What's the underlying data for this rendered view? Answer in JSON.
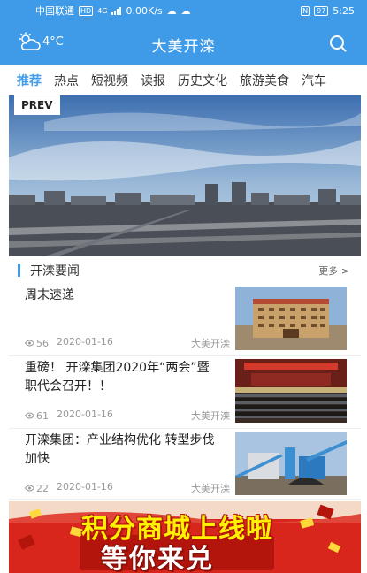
{
  "status_bar": {
    "carrier": "中国联通",
    "hd": "HD",
    "network": "4G",
    "speed": "0.00K/s",
    "nfc": "N",
    "battery": "97",
    "time": "5:25"
  },
  "header": {
    "temperature": "4°C",
    "title": "大美开滦",
    "weather_icon": "cloud-sun-icon",
    "search_icon": "search-icon"
  },
  "tabs": [
    {
      "label": "推荐",
      "active": true
    },
    {
      "label": "热点"
    },
    {
      "label": "短视频"
    },
    {
      "label": "读报"
    },
    {
      "label": "历史文化"
    },
    {
      "label": "旅游美食"
    },
    {
      "label": "汽车"
    }
  ],
  "banner": {
    "prev_label": "PREV"
  },
  "section": {
    "title": "开滦要闻",
    "more": "更多 >"
  },
  "news": [
    {
      "title": "周末速递",
      "views": "56",
      "date": "2020-01-16",
      "source": "大美开滦"
    },
    {
      "title": "重磅！ 开滦集团2020年“两会”暨职代会召开！！",
      "views": "61",
      "date": "2020-01-16",
      "source": "大美开滦"
    },
    {
      "title": "开滦集团：产业结构优化 转型步伐加快",
      "views": "22",
      "date": "2020-01-16",
      "source": "大美开滦"
    }
  ],
  "ad": {
    "line1": "积分商城上线啦",
    "line2": "等你来兑"
  },
  "colors": {
    "primary": "#3f9be8",
    "ad_red": "#d9261c",
    "ad_yellow": "#fff200"
  }
}
